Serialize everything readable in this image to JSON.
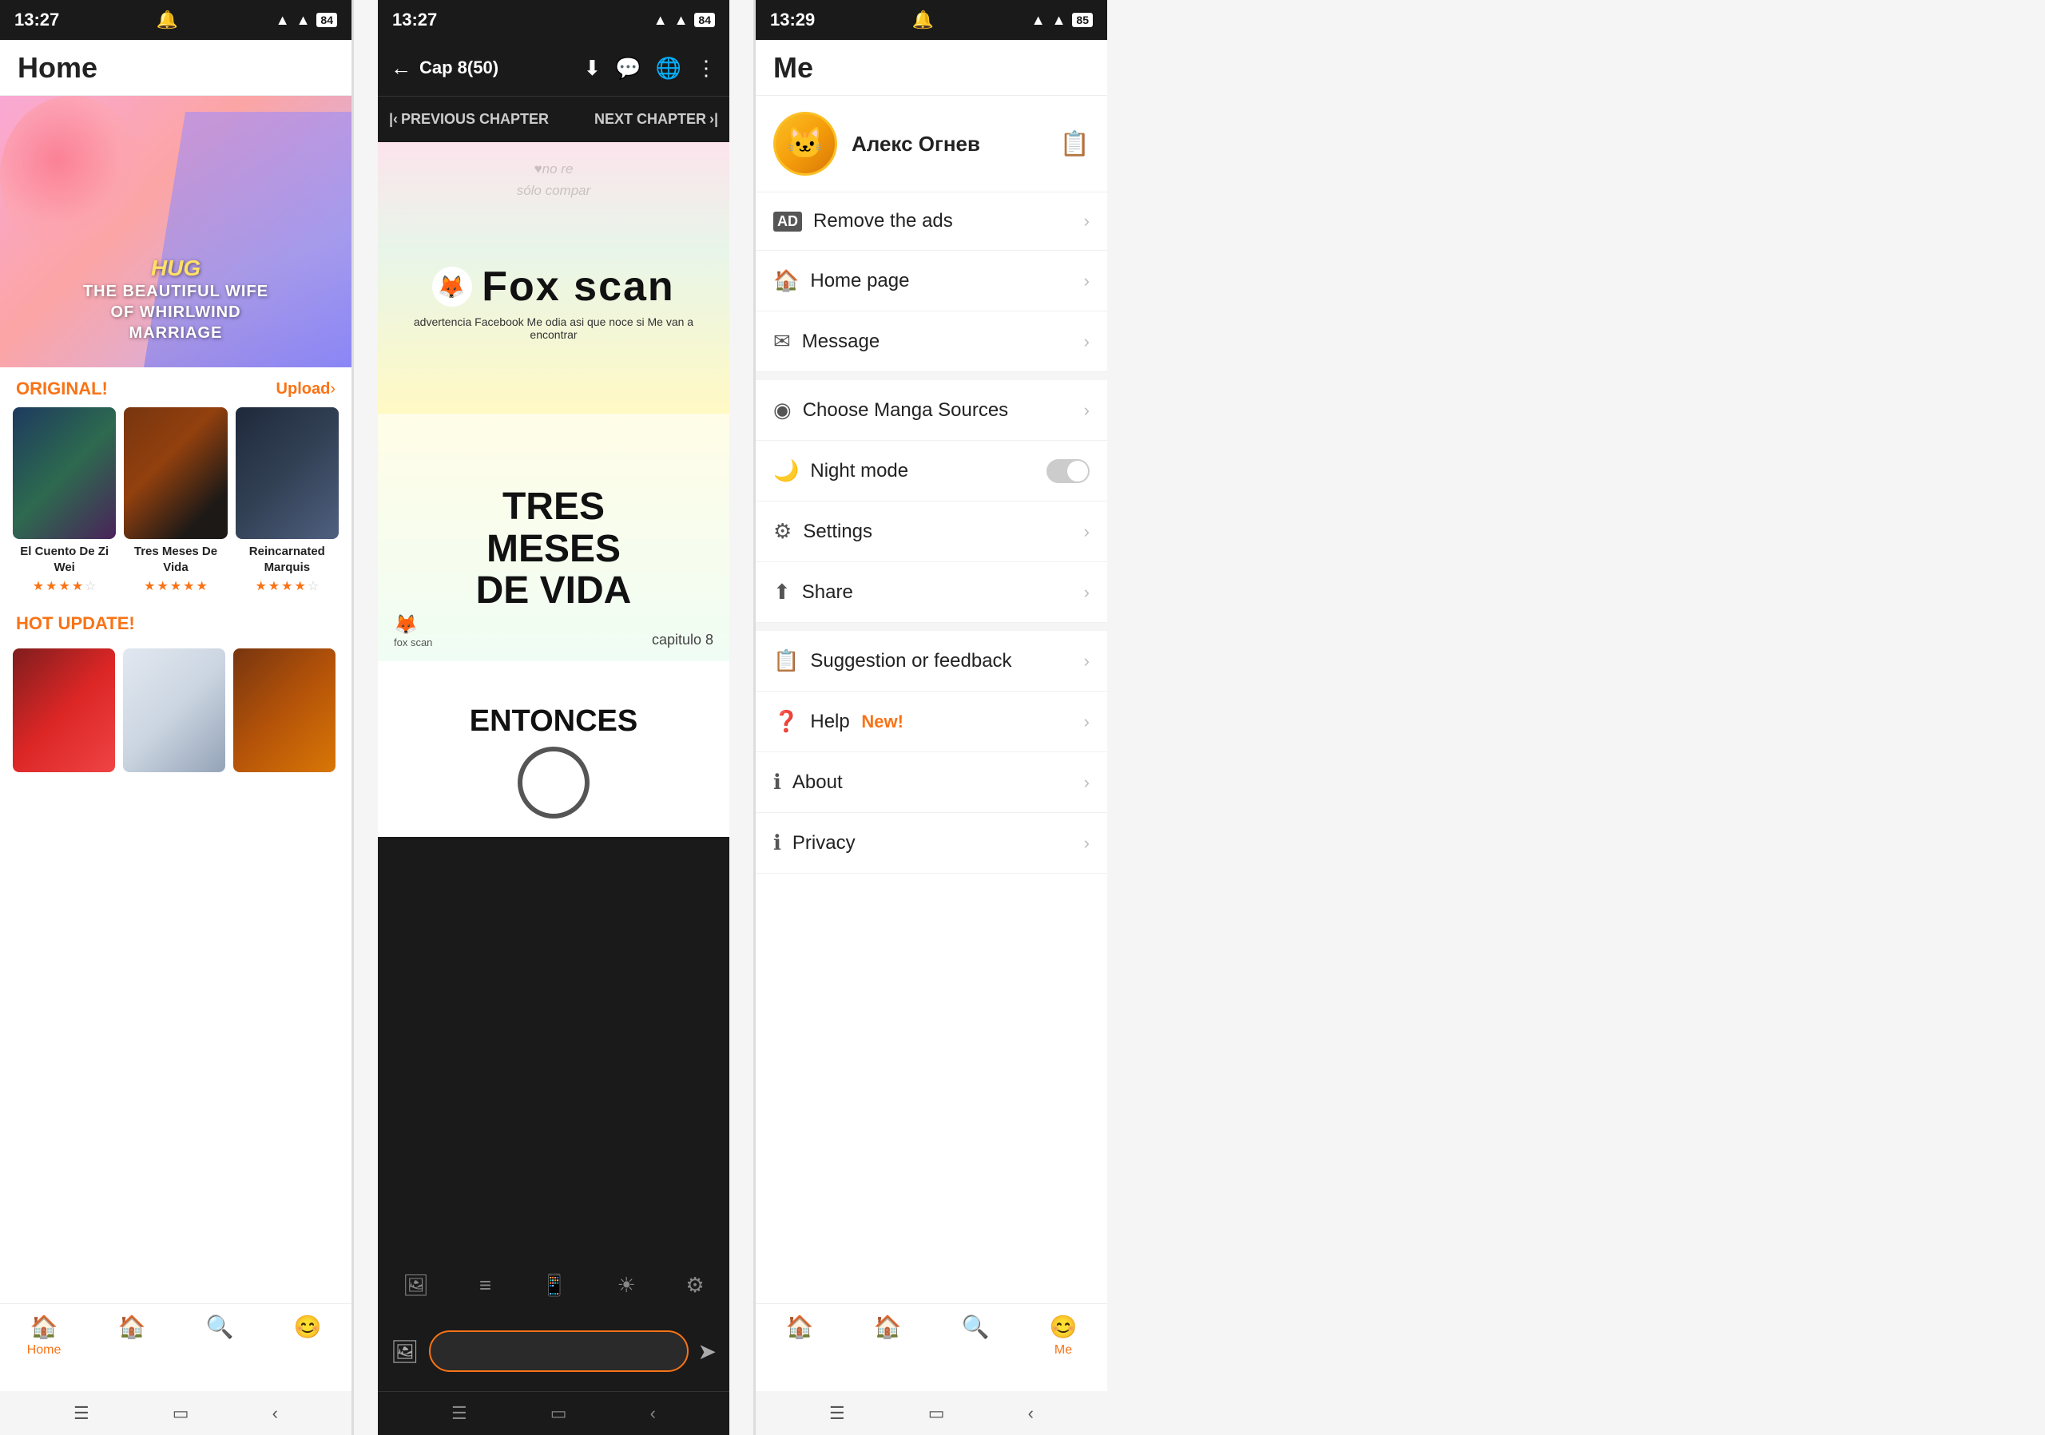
{
  "left": {
    "status": {
      "time": "13:27",
      "signal": "▲",
      "wifi": "▲",
      "battery": "84"
    },
    "title": "Home",
    "banner": {
      "hug": "HUG",
      "line1": "THE BEAUTIFUL WIFE",
      "line2": "OF WHIRLWIND",
      "line3": "MARRIAGE"
    },
    "original_label": "ORIGINAL!",
    "upload_label": "Upload",
    "manga": [
      {
        "title": "El Cuento De Zi Wei",
        "stars": [
          1,
          1,
          1,
          0.5,
          0
        ],
        "bg": "thumb-1"
      },
      {
        "title": "Tres Meses De Vida",
        "stars": [
          1,
          1,
          1,
          1,
          1
        ],
        "bg": "thumb-2"
      },
      {
        "title": "Reincarnated Marquis",
        "stars": [
          1,
          1,
          1,
          0.5,
          0
        ],
        "bg": "thumb-3"
      }
    ],
    "hot_label": "HOT UPDATE!",
    "bottom_nav": [
      {
        "icon": "🏠",
        "label": "Home",
        "active": true
      },
      {
        "icon": "🏠",
        "label": "",
        "active": false
      },
      {
        "icon": "🔍",
        "label": "",
        "active": false
      },
      {
        "icon": "😊",
        "label": "",
        "active": false
      }
    ]
  },
  "mid": {
    "status": {
      "time": "13:27",
      "battery": "84"
    },
    "chapter_title": "Cap 8(50)",
    "prev_chapter": "PREVIOUS CHAPTER",
    "next_chapter": "NEXT CHAPTER",
    "page1": {
      "watermark1": "♥no re",
      "watermark2": "sólo compar",
      "fox_title": "Fox scan",
      "fox_sub": "advertencia Facebook Me odia asi que noce si Me van a encontrar"
    },
    "page2": {
      "title_line1": "TRES",
      "title_line2": "MESES",
      "title_line3": "DE VIDA",
      "capitulo": "capitulo 8",
      "fox_label": "fox scan"
    },
    "page3": {
      "title": "ENTONCES"
    }
  },
  "right": {
    "status": {
      "time": "13:29",
      "battery": "85"
    },
    "title": "Me",
    "profile": {
      "name": "Алекс Огнев"
    },
    "menu": [
      {
        "icon": "AD",
        "label": "Remove the ads",
        "type": "arrow",
        "icon_type": "ad"
      },
      {
        "icon": "🏠",
        "label": "Home page",
        "type": "arrow",
        "icon_type": "normal"
      },
      {
        "icon": "✉",
        "label": "Message",
        "type": "arrow",
        "icon_type": "normal"
      },
      {
        "icon": "◎",
        "label": "Choose Manga Sources",
        "type": "arrow",
        "icon_type": "normal"
      },
      {
        "icon": "🌙",
        "label": "Night mode",
        "type": "toggle",
        "icon_type": "normal"
      },
      {
        "icon": "⚙",
        "label": "Settings",
        "type": "arrow",
        "icon_type": "normal"
      },
      {
        "icon": "⬆",
        "label": "Share",
        "type": "arrow",
        "icon_type": "normal"
      },
      {
        "icon": "📋",
        "label": "Suggestion or feedback",
        "type": "arrow",
        "icon_type": "normal"
      },
      {
        "icon": "?",
        "label": "Help",
        "badge": "New!",
        "type": "arrow",
        "icon_type": "normal"
      },
      {
        "icon": "ℹ",
        "label": "About",
        "type": "arrow",
        "icon_type": "normal"
      },
      {
        "icon": "ℹ",
        "label": "Privacy",
        "type": "arrow",
        "icon_type": "normal"
      }
    ],
    "bottom_nav": [
      {
        "icon": "🏠",
        "label": "",
        "active": false
      },
      {
        "icon": "🏠",
        "label": "",
        "active": false
      },
      {
        "icon": "🔍",
        "label": "",
        "active": false
      },
      {
        "icon": "😊",
        "label": "Me",
        "active": true
      }
    ]
  }
}
